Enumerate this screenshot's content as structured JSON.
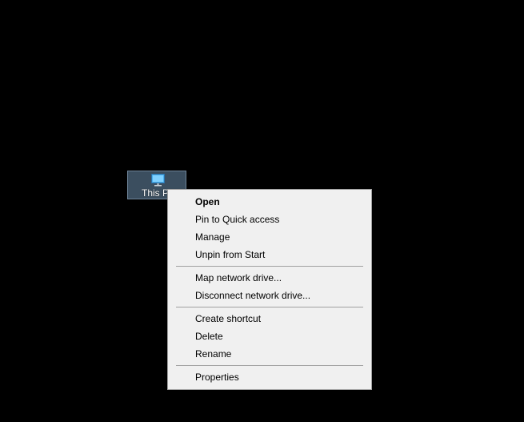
{
  "desktop": {
    "icon": {
      "label": "This P",
      "icon": "computer-monitor-icon"
    }
  },
  "context_menu": {
    "groups": [
      [
        {
          "label": "Open",
          "default": true
        },
        {
          "label": "Pin to Quick access"
        },
        {
          "label": "Manage"
        },
        {
          "label": "Unpin from Start"
        }
      ],
      [
        {
          "label": "Map network drive..."
        },
        {
          "label": "Disconnect network drive..."
        }
      ],
      [
        {
          "label": "Create shortcut"
        },
        {
          "label": "Delete"
        },
        {
          "label": "Rename"
        }
      ],
      [
        {
          "label": "Properties"
        }
      ]
    ]
  },
  "colors": {
    "desktop_background": "#000000",
    "icon_selection": "#3b4e5f",
    "menu_background": "#f0f0f0",
    "menu_border": "#a0a0a0"
  }
}
